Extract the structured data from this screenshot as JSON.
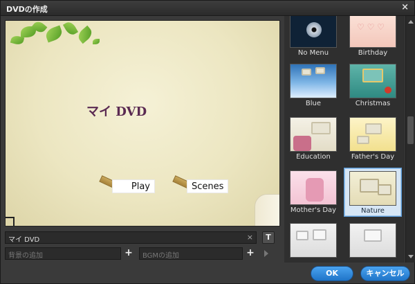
{
  "window": {
    "title": "DVDの作成",
    "close_icon": "×"
  },
  "preview": {
    "title": "マイ DVD",
    "buttons": {
      "play": "Play",
      "scenes": "Scenes"
    }
  },
  "inputs": {
    "menu_title_value": "マイ DVD",
    "background_placeholder": "背景の追加",
    "bgm_placeholder": "BGMの追加"
  },
  "controls": {
    "text_button": "T",
    "plus": "+",
    "clear": "×"
  },
  "templates": [
    {
      "label": "No Menu"
    },
    {
      "label": "Birthday"
    },
    {
      "label": "Blue"
    },
    {
      "label": "Christmas"
    },
    {
      "label": "Education"
    },
    {
      "label": "Father's Day"
    },
    {
      "label": "Mother's Day"
    },
    {
      "label": "Nature",
      "selected": true
    }
  ],
  "footer": {
    "ok": "OK",
    "cancel": "キャンセル"
  },
  "colors": {
    "accent": "#2d86d8",
    "title_purple": "#5a2a52",
    "background": "#3a3a3a"
  }
}
